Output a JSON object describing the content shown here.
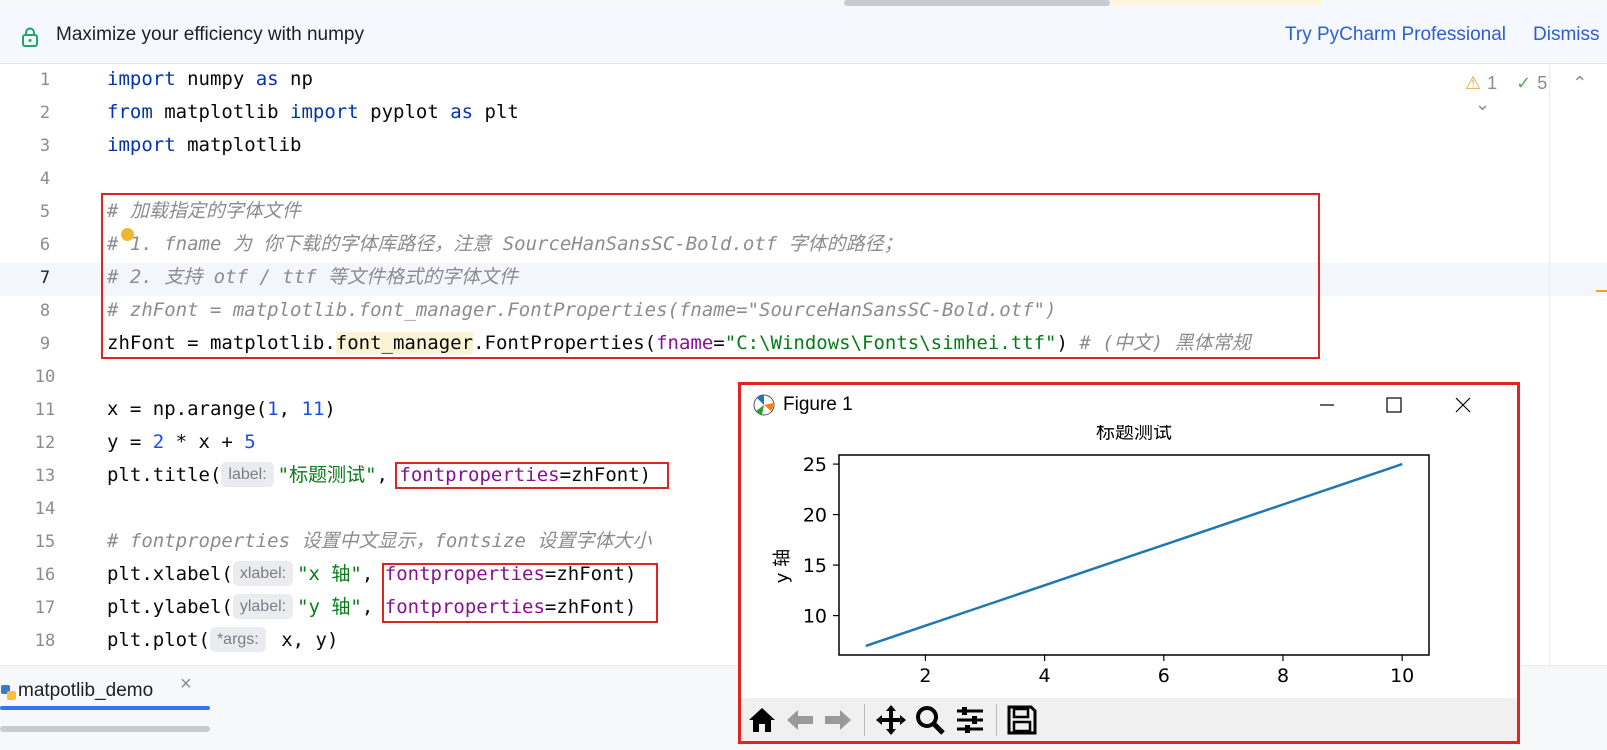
{
  "banner": {
    "message": "Maximize your efficiency with numpy",
    "try_link": "Try PyCharm Professional",
    "dismiss_link": "Dismiss"
  },
  "inspections": {
    "warnings": "1",
    "checks": "5"
  },
  "gutter": [
    "1",
    "2",
    "3",
    "4",
    "5",
    "6",
    "7",
    "8",
    "9",
    "10",
    "11",
    "12",
    "13",
    "14",
    "15",
    "16",
    "17",
    "18"
  ],
  "code": {
    "l1": {
      "kw1": "import",
      "mid": " numpy ",
      "kw2": "as",
      "tail": " np"
    },
    "l2": {
      "kw1": "from",
      "mid": " matplotlib ",
      "kw2": "import",
      "mid2": " pyplot ",
      "kw3": "as",
      "tail": " plt"
    },
    "l3": {
      "kw1": "import",
      "tail": " matplotlib"
    },
    "l5": "# 加载指定的字体文件",
    "l6": "# 1. fname 为 你下载的字体库路径，注意 SourceHanSansSC-Bold.otf 字体的路径；",
    "l7": "# 2. 支持 otf / ttf 等文件格式的字体文件",
    "l8": "# zhFont = matplotlib.font_manager.FontProperties(fname=\"SourceHanSansSC-Bold.otf\")",
    "l9": {
      "a": "zhFont = matplotlib.",
      "b": "font_manager",
      "c": ".FontProperties(",
      "p": "fname",
      "eq": "=",
      "s": "\"C:\\Windows\\Fonts\\simhei.ttf\"",
      "close": ") ",
      "cmt": "# (中文) 黑体常规"
    },
    "l11": {
      "a": "x = np.arange(",
      "n1": "1",
      "sep": ", ",
      "n2": "11",
      "close": ")"
    },
    "l12": {
      "a": "y = ",
      "n1": "2",
      "b": " * x + ",
      "n2": "5"
    },
    "l13": {
      "a": "plt.title(",
      "hint": "label:",
      "s": "\"标题测试\"",
      "sep": ", ",
      "p": "fontproperties",
      "eq": "=zhFont",
      "close": ")"
    },
    "l15": "# fontproperties 设置中文显示，fontsize 设置字体大小",
    "l16": {
      "a": "plt.xlabel(",
      "hint": "xlabel:",
      "s": "\"x 轴\"",
      "sep": ", ",
      "p": "fontproperties",
      "eq": "=zhFont",
      "close": ")"
    },
    "l17": {
      "a": "plt.ylabel(",
      "hint": "ylabel:",
      "s": "\"y 轴\"",
      "sep": ", ",
      "p": "fontproperties",
      "eq": "=zhFont",
      "close": ")"
    },
    "l18": {
      "a": "plt.plot(",
      "hint": "*args:",
      "tail": " x, y)"
    }
  },
  "tab": {
    "label": "matpotlib_demo",
    "close": "×"
  },
  "figure": {
    "window_title": "Figure 1",
    "toolbar_icons": [
      "home-icon",
      "back-icon",
      "forward-icon",
      "pan-icon",
      "zoom-icon",
      "configure-icon",
      "save-icon"
    ]
  },
  "chart_data": {
    "type": "line",
    "title": "标题测试",
    "ylabel": "y 轴",
    "xlabel": "",
    "x": [
      1,
      2,
      3,
      4,
      5,
      6,
      7,
      8,
      9,
      10
    ],
    "series": [
      {
        "values": [
          7,
          9,
          11,
          13,
          15,
          17,
          19,
          21,
          23,
          25
        ],
        "color": "#1f77b4"
      }
    ],
    "xticks": [
      2,
      4,
      6,
      8,
      10
    ],
    "yticks": [
      10,
      15,
      20,
      25
    ],
    "xlim": [
      0.55,
      10.45
    ],
    "ylim": [
      6.1,
      25.9
    ],
    "grid": false
  },
  "colors": {
    "highlight_box": "#e02424",
    "keyword": "#0033b3",
    "string": "#067d17",
    "link": "#2c5fd0"
  }
}
